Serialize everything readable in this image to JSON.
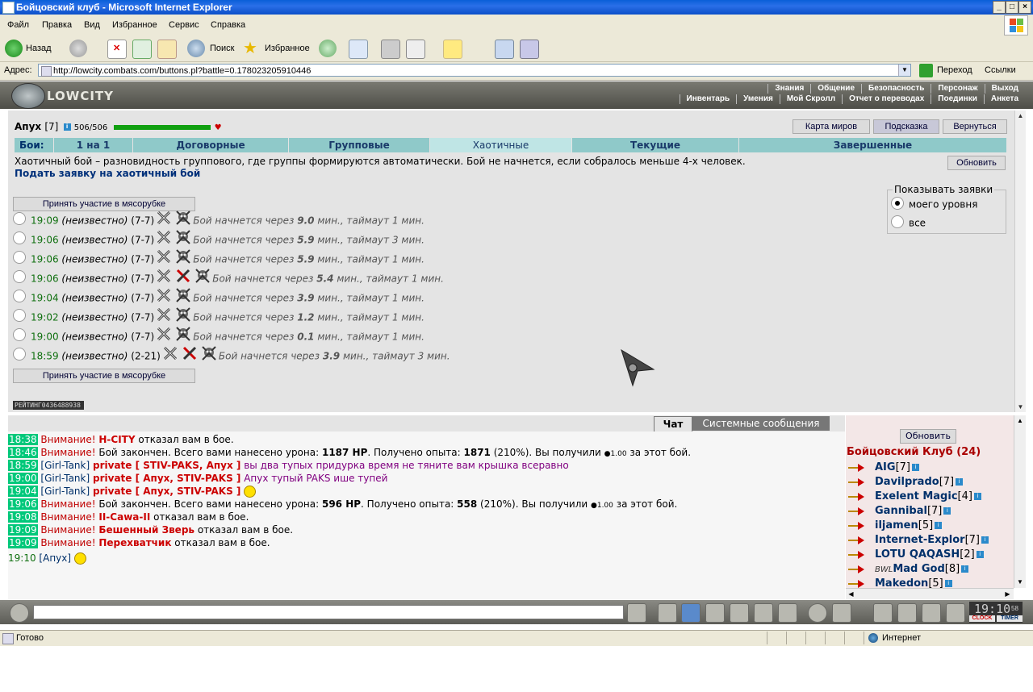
{
  "window": {
    "title": "Бойцовский клуб - Microsoft Internet Explorer",
    "min": "_",
    "max": "□",
    "close": "×"
  },
  "menu": [
    "Файл",
    "Правка",
    "Вид",
    "Избранное",
    "Сервис",
    "Справка"
  ],
  "toolbar": {
    "back": "Назад",
    "search": "Поиск",
    "favorites": "Избранное"
  },
  "address": {
    "label": "Адрес:",
    "url": "http://lowcity.combats.com/buttons.pl?battle=0.178023205910446",
    "go": "Переход",
    "links": "Ссылки"
  },
  "game_header": {
    "logo": "LOWCITY",
    "nav_top": [
      "Знания",
      "Общение",
      "Безопасность",
      "Персонаж",
      "Выход"
    ],
    "nav_bottom": [
      "Инвентарь",
      "Умения",
      "Мой Скролл",
      "Отчет о переводах",
      "Поединки",
      "Анкета"
    ]
  },
  "player": {
    "name": "Апух",
    "level": "[7]",
    "hp": "506/506",
    "hp_fraction": 1.0
  },
  "top_buttons": [
    "Карта миров",
    "Подсказка",
    "Вернуться"
  ],
  "tabs": {
    "label": "Бои:",
    "items": [
      "1 на 1",
      "Договорные",
      "Групповые",
      "Хаотичные",
      "Текущие",
      "Завершенные"
    ],
    "active": "Хаотичные"
  },
  "description": "Хаотичный бой – разновидность группового, где группы формируются автоматически. Бой не начнется, если собралось меньше 4-х человек.",
  "apply_link": "Подать заявку на хаотичный бой",
  "refresh_button": "Обновить",
  "join_button": "Принять участие в мясорубке",
  "filter": {
    "legend": "Показывать заявки",
    "options": [
      "моего уровня",
      "все"
    ],
    "selected": "моего уровня"
  },
  "fights": [
    {
      "time": "19:09",
      "who": "(неизвестно)",
      "range": "(7-7)",
      "icons": [
        "crossed-swords",
        "skull"
      ],
      "pre": "Бой начнется через",
      "mins": "9.0",
      "post": "мин., таймаут 1 мин."
    },
    {
      "time": "19:06",
      "who": "(неизвестно)",
      "range": "(7-7)",
      "icons": [
        "crossed-swords",
        "skull"
      ],
      "pre": "Бой начнется через",
      "mins": "5.9",
      "post": "мин., таймаут 3 мин."
    },
    {
      "time": "19:06",
      "who": "(неизвестно)",
      "range": "(7-7)",
      "icons": [
        "crossed-swords",
        "skull"
      ],
      "pre": "Бой начнется через",
      "mins": "5.9",
      "post": "мин., таймаут 1 мин."
    },
    {
      "time": "19:06",
      "who": "(неизвестно)",
      "range": "(7-7)",
      "icons": [
        "crossed-swords",
        "red-swords",
        "skull"
      ],
      "pre": "Бой начнется через",
      "mins": "5.4",
      "post": "мин., таймаут 1 мин."
    },
    {
      "time": "19:04",
      "who": "(неизвестно)",
      "range": "(7-7)",
      "icons": [
        "crossed-swords",
        "skull"
      ],
      "pre": "Бой начнется через",
      "mins": "3.9",
      "post": "мин., таймаут 1 мин."
    },
    {
      "time": "19:02",
      "who": "(неизвестно)",
      "range": "(7-7)",
      "icons": [
        "crossed-swords",
        "skull"
      ],
      "pre": "Бой начнется через",
      "mins": "1.2",
      "post": "мин., таймаут 1 мин."
    },
    {
      "time": "19:00",
      "who": "(неизвестно)",
      "range": "(7-7)",
      "icons": [
        "crossed-swords",
        "skull"
      ],
      "pre": "Бой начнется через",
      "mins": "0.1",
      "post": "мин., таймаут 1 мин."
    },
    {
      "time": "18:59",
      "who": "(неизвестно)",
      "range": "(2-21)",
      "icons": [
        "crossed-swords",
        "red-swords",
        "skull"
      ],
      "pre": "Бой начнется через",
      "mins": "3.9",
      "post": "мин., таймаут 3 мин."
    }
  ],
  "rating": "РЕЙТИНГ0436488938",
  "chat_tabs": [
    "Чат",
    "Системные сообщения"
  ],
  "chat": [
    {
      "ts": "18:38",
      "warn": "Внимание!",
      "nick": "H-CITY",
      "text": " отказал вам в бое."
    },
    {
      "ts": "18:46",
      "warn": "Внимание!",
      "text": " Бой закончен. Всего вами нанесено урона: ",
      "b1": "1187 HP",
      "t2": ". Получено опыта: ",
      "b2": "1871",
      "t3": " (210%). Вы получили ",
      "money": "1.00",
      "t4": " за этот бой."
    },
    {
      "ts": "18:59",
      "from": "[Girl-Tank]",
      "priv": "private [ STIV-PAKS, Апух ]",
      "pm": " вы два тупых придурка время не тяните вам крышка всеравно"
    },
    {
      "ts": "19:00",
      "from": "[Girl-Tank]",
      "priv": "private [ Апух, STIV-PAKS ]",
      "pm": " Апух тупый PAKS ише тупей"
    },
    {
      "ts": "19:04",
      "from": "[Girl-Tank]",
      "priv": "private [ Апух, STIV-PAKS ]",
      "smile": true
    },
    {
      "ts": "19:06",
      "warn": "Внимание!",
      "text": " Бой закончен. Всего вами нанесено урона: ",
      "b1": "596 HP",
      "t2": ". Получено опыта: ",
      "b2": "558",
      "t3": " (210%). Вы получили ",
      "money": "1.00",
      "t4": " за этот бой."
    },
    {
      "ts": "19:08",
      "warn": "Внимание!",
      "nick": "II-Cawa-II",
      "text": " отказал вам в бое."
    },
    {
      "ts": "19:09",
      "warn": "Внимание!",
      "nick": "Бешенный Зверь",
      "text": " отказал вам в бое."
    },
    {
      "ts": "19:09",
      "warn": "Внимание!",
      "nick": "Перехватчик",
      "text": " отказал вам в бое."
    }
  ],
  "chat_last": {
    "ts": "19:10",
    "self": "[Апух]"
  },
  "users": {
    "refresh": "Обновить",
    "title": "Бойцовский Клуб (24)",
    "list": [
      {
        "name": "AIG",
        "level": "[7]"
      },
      {
        "name": "Davilprado",
        "level": "[7]"
      },
      {
        "name": "Exelent Magic",
        "level": "[4]"
      },
      {
        "name": "Gannibal",
        "level": "[7]"
      },
      {
        "name": "iljamen",
        "level": "[5]"
      },
      {
        "name": "Internet-Explor",
        "level": "[7]"
      },
      {
        "name": "LOTU QAQASH",
        "level": "[2]"
      },
      {
        "name": "Mad God",
        "level": "[8]",
        "clan": "BWL"
      },
      {
        "name": "Makedon",
        "level": "[5]"
      }
    ]
  },
  "clock": {
    "time": "19:10",
    "sec": "58",
    "label1": "CLOCK",
    "label2": "TIMER"
  },
  "status": {
    "text": "Готово",
    "zone": "Интернет"
  },
  "colors": {
    "accent": "#8fc9c9",
    "hp": "#10a010",
    "warning": "#c00000",
    "link": "#00306a"
  }
}
